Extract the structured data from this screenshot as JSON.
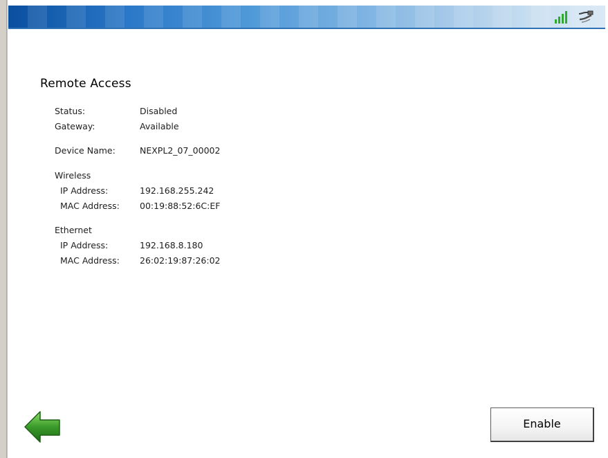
{
  "page": {
    "title": "Remote Access"
  },
  "status_bar": {
    "signal_icon": "signal-bars-icon",
    "connection_icon": "ethernet-plug-icon",
    "signal_color": "#2eaa2e"
  },
  "general": {
    "status_label": "Status:",
    "status_value": "Disabled",
    "gateway_label": "Gateway:",
    "gateway_value": "Available",
    "device_name_label": "Device Name:",
    "device_name_value": "NEXPL2_07_00002"
  },
  "wireless": {
    "heading": "Wireless",
    "ip_label": "IP Address:",
    "ip_value": "192.168.255.242",
    "mac_label": "MAC Address:",
    "mac_value": "00:19:88:52:6C:EF"
  },
  "ethernet": {
    "heading": "Ethernet",
    "ip_label": "IP Address:",
    "ip_value": "192.168.8.180",
    "mac_label": "MAC Address:",
    "mac_value": "26:02:19:87:26:02"
  },
  "footer": {
    "back_icon": "back-arrow-icon",
    "enable_label": "Enable",
    "accent": "#3a9a2a"
  }
}
